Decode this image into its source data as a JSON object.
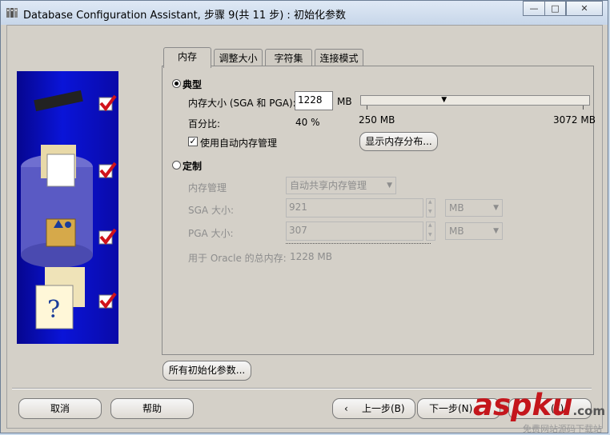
{
  "window": {
    "title": "Database Configuration Assistant, 步骤 9(共 11 步) : 初始化参数",
    "min_glyph": "—",
    "max_glyph": "□",
    "close_glyph": "✕"
  },
  "tabs": [
    {
      "label": "内存",
      "active": true
    },
    {
      "label": "调整大小",
      "active": false
    },
    {
      "label": "字符集",
      "active": false
    },
    {
      "label": "连接模式",
      "active": false
    }
  ],
  "memory": {
    "typical_label": "典型",
    "mem_size_label": "内存大小 (SGA 和 PGA):",
    "mem_size_value": "1228",
    "mem_unit": "MB",
    "percent_label": "百分比:",
    "percent_value": "40 %",
    "slider_min": "250 MB",
    "slider_max": "3072 MB",
    "slider_fraction": 0.36,
    "auto_mem_label": "使用自动内存管理",
    "auto_mem_checked": true,
    "show_dist_button": "显示内存分布...",
    "custom_label": "定制",
    "mem_mgmt_label": "内存管理",
    "mem_mgmt_value": "自动共享内存管理",
    "sga_label": "SGA 大小:",
    "sga_value": "921",
    "sga_unit": "MB",
    "pga_label": "PGA 大小:",
    "pga_value": "307",
    "pga_unit": "MB",
    "total_label": "用于 Oracle 的总内存:",
    "total_value": "1228 MB"
  },
  "all_params_button": "所有初始化参数...",
  "footer": {
    "cancel": "取消",
    "help": "帮助",
    "back": "上一步(B)",
    "next": "下一步(N)",
    "finish_partial": "(F)"
  },
  "watermark": {
    "main": "aspku",
    "com": ".com",
    "sub": "免费网站源码下载站"
  },
  "colors": {
    "accent_red": "#c4161c",
    "panel_blue": "#0a14d8",
    "check_red": "#d0121b"
  }
}
